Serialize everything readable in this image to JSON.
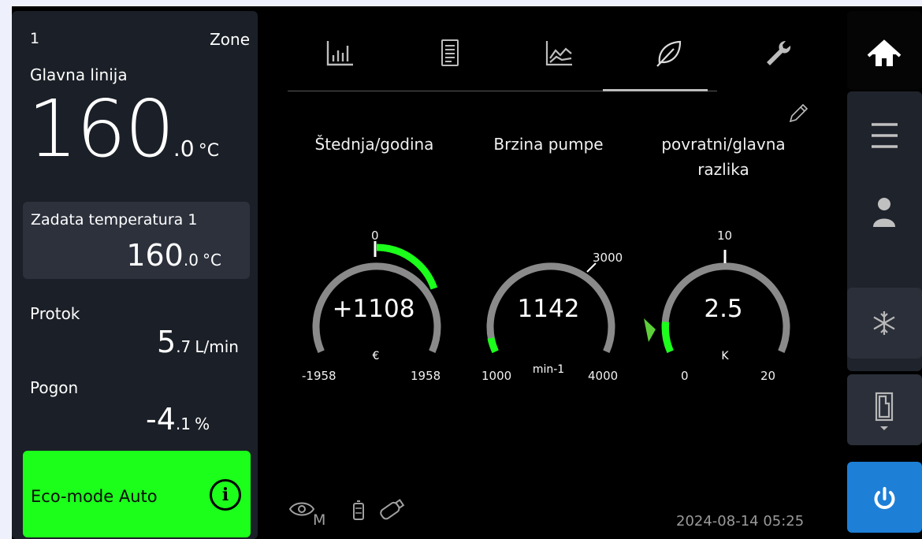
{
  "zone": {
    "number": "1",
    "label": "Zone"
  },
  "line": {
    "name": "Glavna linija"
  },
  "main_temp": {
    "int": "160",
    "dec": ".0",
    "unit": "°C"
  },
  "setpoint": {
    "label": "Zadata temperatura 1",
    "int": "160",
    "dec": ".0",
    "unit": "°C"
  },
  "flow": {
    "label": "Protok",
    "int": "5",
    "dec": ".7",
    "unit": "L/min"
  },
  "drive": {
    "label": "Pogon",
    "int": "-4",
    "dec": ".1",
    "unit": "%"
  },
  "eco": {
    "label": "Eco-mode Auto",
    "info_icon": "i",
    "color": "#1bff1b"
  },
  "tabs": [
    {
      "icon": "bar-chart-icon"
    },
    {
      "icon": "document-icon"
    },
    {
      "icon": "line-chart-icon"
    },
    {
      "icon": "leaf-icon",
      "active": true
    },
    {
      "icon": "wrench-icon"
    }
  ],
  "gauges": [
    {
      "title": "Štednja/godina",
      "value": "+1108",
      "unit": "€",
      "min": "-1958",
      "max": "1958",
      "top": "0",
      "level": 1108,
      "range": [
        -1958,
        1958
      ]
    },
    {
      "title": "Brzina pumpe",
      "value": "1142",
      "unit": "min-1",
      "min": "1000",
      "max": "4000",
      "top": "3000",
      "level": 1142,
      "range": [
        1000,
        4000
      ]
    },
    {
      "title_line1": "povratni/glavna",
      "title_line2": "razlika",
      "value": "2.5",
      "unit": "K",
      "min": "0",
      "max": "20",
      "top": "10",
      "level": 2.5,
      "range": [
        0,
        20
      ]
    }
  ],
  "footer": {
    "mode_letter": "M",
    "datetime": "2024-08-14 05:25"
  },
  "nav": [
    "home-icon",
    "menu-icon",
    "user-icon",
    "snowflake-icon",
    "door-icon",
    "power-icon"
  ],
  "colors": {
    "accent_green": "#1bff1b",
    "gauge_track": "#8a8a8a",
    "power_blue": "#1e7fd6"
  }
}
